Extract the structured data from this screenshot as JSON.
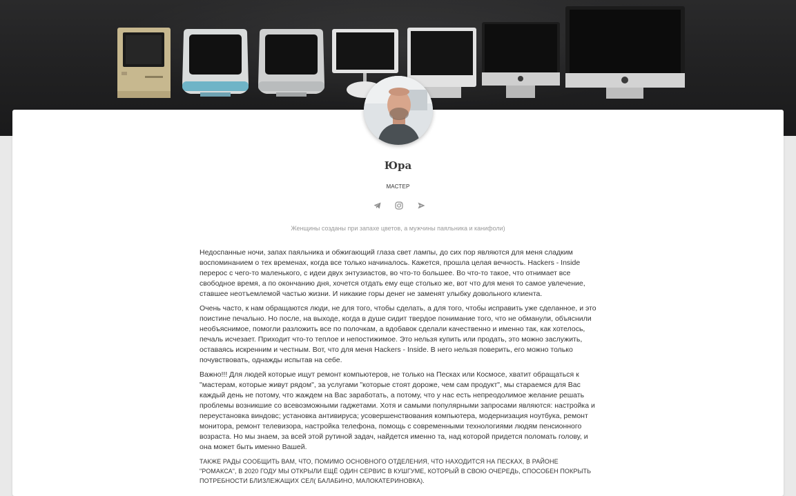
{
  "hero": {
    "computers": [
      "macintosh-classic-icon",
      "imac-g3-blue-icon",
      "imac-g3-graphite-icon",
      "imac-g4-icon",
      "imac-g5-icon",
      "imac-aluminum-icon",
      "imac-unibody-icon"
    ]
  },
  "profile": {
    "name": "Юра",
    "role": "МАСТЕР",
    "quote": "Женщины созданы при запахе цветов, а мужчины паяльника и канифоли)"
  },
  "socials": [
    {
      "name": "telegram-icon",
      "label": "Telegram"
    },
    {
      "name": "instagram-icon",
      "label": "Instagram"
    },
    {
      "name": "send-icon",
      "label": "Send"
    }
  ],
  "content": {
    "p1": "Недоспанные ночи, запах паяльника и обжигающий глаза свет лампы, до сих пор являются для меня сладким воспоминанием о тех временах, когда все только начиналось. Кажется, прошла целая вечность. Hackers - Inside перерос с чего-то маленького, с идеи двух энтузиастов, во что-то большее. Во что-то такое, что отнимает все свободное время, а по окончанию дня, хочется отдать ему еще столько же, вот что для меня то самое увлечение, ставшее неотъемлемой частью жизни. И никакие горы денег не заменят улыбку довольного клиента.",
    "p2": "Очень часто, к нам обращаются люди, не для того, чтобы сделать, а для того, чтобы исправить уже сделанное, и это поистине печально. Но после, на выходе, когда в душе сидит твердое понимание того, что не обманули, объяснили необъяснимое, помогли разложить все по полочкам, а вдобавок сделали качественно и именно так, как хотелось, печаль исчезает. Приходит что-то теплое и непостижимое. Это нельзя купить или продать, это можно заслужить, оставаясь искренним и честным. Вот, что для меня Hackers - Inside. В него нельзя поверить, его можно только почувствовать, однажды испытав на себе.",
    "p3": "Важно!!! Для людей которые ищут ремонт компьютеров, не только на Песках или Космосе, хватит обращаться к \"мастерам, которые живут рядом\", за услугами \"которые стоят дороже, чем сам продукт\", мы стараемся для Вас каждый день не потому, что жаждем на Вас заработать, а потому, что у нас есть непреодолимое желание решать проблемы возникшие со всевозможными гаджетами. Хотя и самыми популярными запросами являются: настройка и переустановка виндовс; установка антивируса; усовершенствования компьютера, модернизация ноутбука, ремонт монитора, ремонт телевизора, настройка телефона, помощь с современными технологиями людям пенсионного возраста. Но мы знаем, за всей этой рутиной задач, найдется именно та, над которой придется поломать голову, и она может быть именно Вашей.",
    "p4": "Также рады сообщить Вам, что, помимо основного отделения, что находится на Песках, в районе \"Ромакса\", в 2020 году мы открыли ещё один сервис в Кушгуме, который в свою очередь, способен покрыть потребности близлежащих сел( Балабино, Малокатериновка)."
  }
}
